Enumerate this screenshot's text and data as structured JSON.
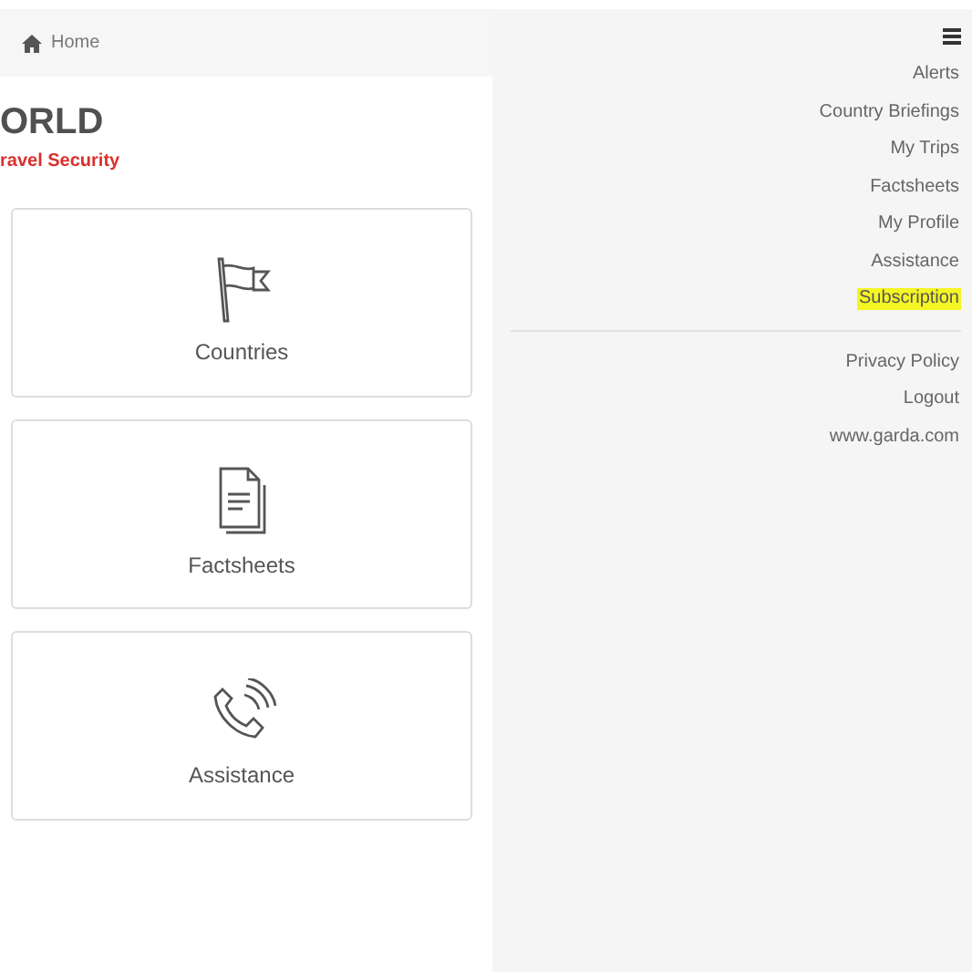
{
  "header": {
    "home_label": "Home"
  },
  "logo": {
    "title": "ORLD",
    "subtitle": "ravel Security"
  },
  "tiles": [
    {
      "kind": "flag",
      "label": "Countries"
    },
    {
      "kind": "document",
      "label": "Factsheets"
    },
    {
      "kind": "phone",
      "label": "Assistance"
    }
  ],
  "menu": {
    "items": [
      {
        "label": "Alerts",
        "highlighted": false
      },
      {
        "label": "Country Briefings",
        "highlighted": false
      },
      {
        "label": "My Trips",
        "highlighted": false
      },
      {
        "label": "Factsheets",
        "highlighted": false
      },
      {
        "label": "My Profile",
        "highlighted": false
      },
      {
        "label": "Assistance",
        "highlighted": false
      },
      {
        "label": "Subscription",
        "highlighted": true
      }
    ],
    "secondary_items": [
      {
        "label": "Privacy Policy"
      },
      {
        "label": "Logout"
      },
      {
        "label": "www.garda.com"
      }
    ]
  }
}
